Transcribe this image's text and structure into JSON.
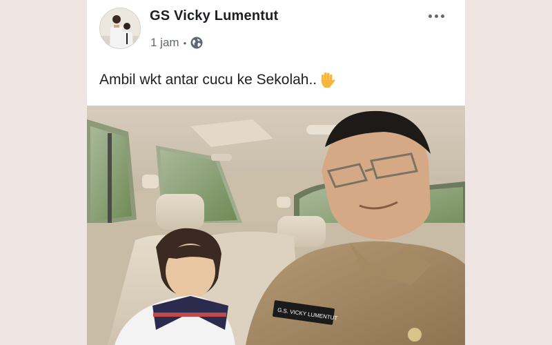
{
  "post": {
    "author": "GS Vicky Lumentut",
    "time": "1 jam",
    "separator": "•",
    "privacy_icon": "globe-icon",
    "text": "Ambil wkt antar cucu ke Sekolah..",
    "emoji_icon": "raised-hand-icon",
    "photo": {
      "name_tag": "G.S. VICKY LUMENTUT"
    }
  },
  "colors": {
    "page_background": "#efe6e4",
    "card_background": "#ffffff",
    "author_text": "#1c1e21",
    "meta_text": "#616770"
  }
}
